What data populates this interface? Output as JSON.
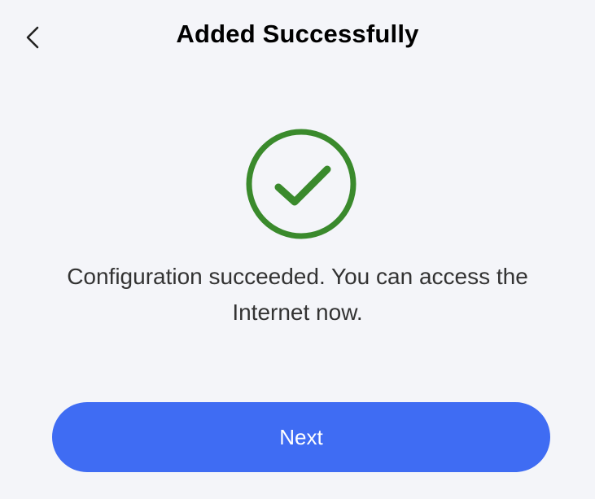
{
  "header": {
    "back_icon": "chevron-left-icon",
    "title": "Added Successfully"
  },
  "status": {
    "icon": "check-circle-icon",
    "color": "#3a8a2c",
    "message_line1": "Configuration succeeded. You can access the",
    "message_line2": "Internet now."
  },
  "actions": {
    "next_label": "Next",
    "accent_color": "#3f6cf3"
  }
}
